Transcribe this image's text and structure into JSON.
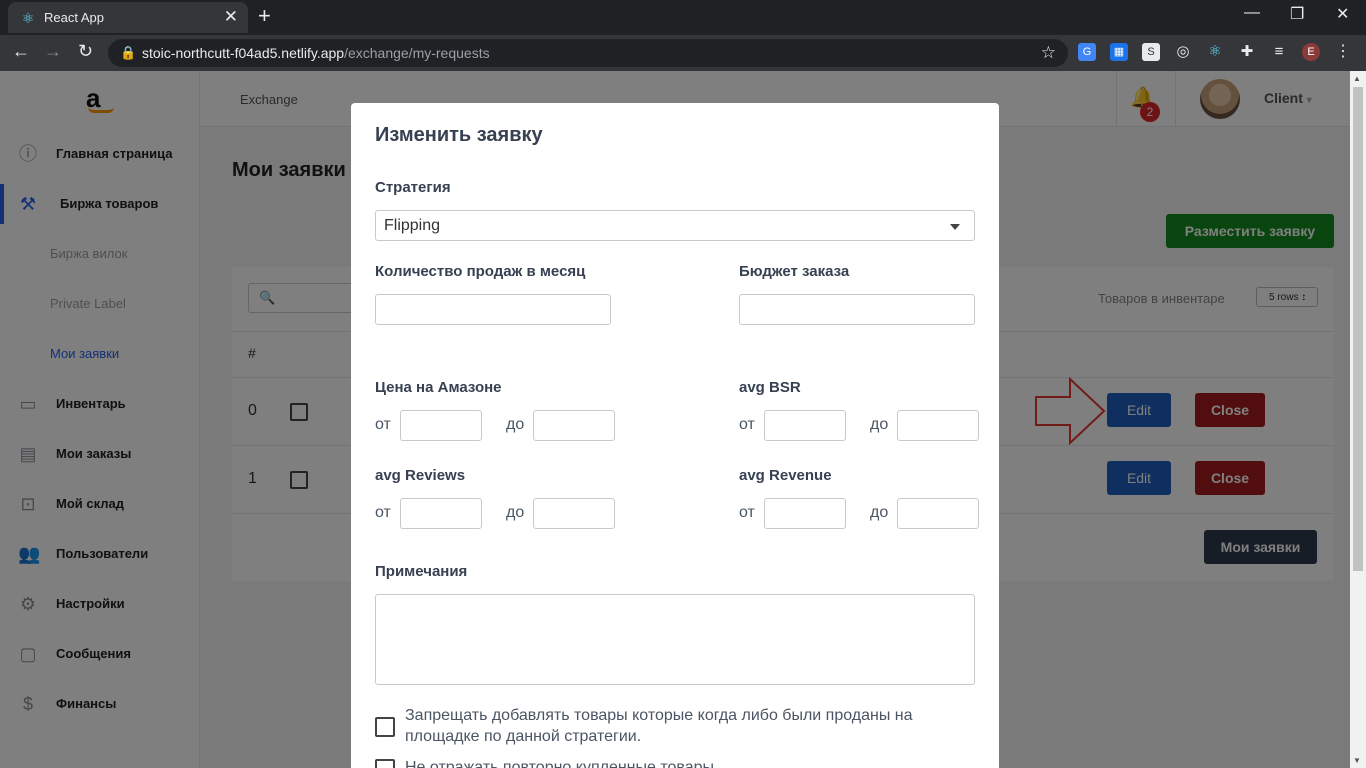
{
  "browser": {
    "tab_title": "React App",
    "url_host": "stoic-northcutt-f04ad5.netlify.app",
    "url_path": "/exchange/my-requests",
    "profile_initial": "E"
  },
  "sidebar": {
    "logo": "a",
    "items": [
      {
        "label": "Главная страница",
        "icon": "info-icon"
      },
      {
        "label": "Биржа товаров",
        "icon": "gavel-icon"
      },
      {
        "label": "Биржа вилок"
      },
      {
        "label": "Private Label"
      },
      {
        "label": "Мои заявки"
      },
      {
        "label": "Инвентарь",
        "icon": "inbox-icon"
      },
      {
        "label": "Мои заказы",
        "icon": "clipboard-icon"
      },
      {
        "label": "Мой склад",
        "icon": "archive-icon"
      },
      {
        "label": "Пользователи",
        "icon": "users-icon"
      },
      {
        "label": "Настройки",
        "icon": "gear-icon"
      },
      {
        "label": "Сообщения",
        "icon": "message-icon"
      },
      {
        "label": "Финансы",
        "icon": "dollar-icon"
      }
    ]
  },
  "header": {
    "breadcrumb": "Exchange",
    "notification_count": "2",
    "user": "Client"
  },
  "main": {
    "title": "Мои заявки",
    "place_button": "Разместить заявку",
    "inventory_label": "Товаров в инвентаре",
    "rows_select": "5 rows",
    "column_hash": "#",
    "rows": [
      {
        "num": "0",
        "edit": "Edit",
        "close": "Close"
      },
      {
        "num": "1",
        "edit": "Edit",
        "close": "Close"
      }
    ],
    "my_requests_button": "Мои заявки"
  },
  "modal": {
    "title": "Изменить заявку",
    "strategy_label": "Стратегия",
    "strategy_value": "Flipping",
    "sales_label": "Количество продаж в месяц",
    "budget_label": "Бюджет заказа",
    "price_label": "Цена на Амазоне",
    "bsr_label": "avg BSR",
    "reviews_label": "avg Reviews",
    "revenue_label": "avg Revenue",
    "from": "от",
    "to": "до",
    "notes_label": "Примечания",
    "checkbox1": "Запрещать добавлять товары которые когда либо были проданы на площадке по данной стратегии.",
    "checkbox2": "Не отражать повторно купленные товары"
  },
  "colors": {
    "accent_blue": "#1d5fbf",
    "danger_red": "#a51d1d",
    "success_green": "#128a1c",
    "dark_button": "#2d3a4f",
    "annotation_arrow": "#e53935"
  }
}
